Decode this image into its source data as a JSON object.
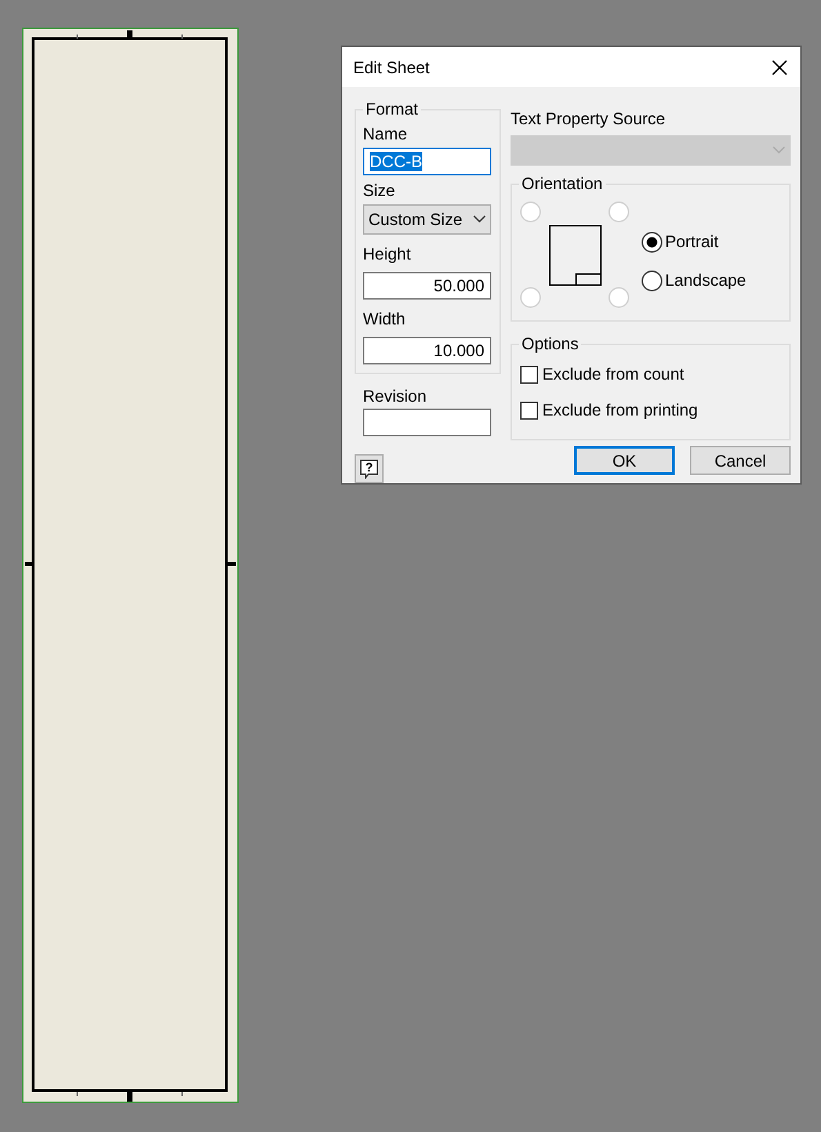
{
  "dialog": {
    "title": "Edit Sheet",
    "help_button": {
      "label": "?"
    },
    "format": {
      "legend": "Format",
      "name": {
        "label": "Name",
        "value": "DCC-B",
        "text_selected": true
      },
      "size": {
        "label": "Size",
        "value": "Custom Size"
      },
      "height": {
        "label": "Height",
        "value": "50.000"
      },
      "width": {
        "label": "Width",
        "value": "10.000"
      }
    },
    "revision": {
      "label": "Revision"
    },
    "text_property_source": {
      "label": "Text Property Source",
      "disabled": true
    },
    "orientation": {
      "legend": "Orientation",
      "anchors": [
        {
          "selected": false
        },
        {
          "selected": false
        },
        {
          "selected": false
        },
        {
          "selected": false
        }
      ],
      "choices": [
        {
          "label": "Portrait",
          "selected": true
        },
        {
          "label": "Landscape",
          "selected": false
        }
      ]
    },
    "options": {
      "legend": "Options",
      "items": [
        {
          "label": "Exclude from count",
          "checked": false
        },
        {
          "label": "Exclude from printing",
          "checked": false
        }
      ]
    },
    "buttons": [
      {
        "label": "OK",
        "default": true
      },
      {
        "label": "Cancel",
        "default": false
      }
    ]
  }
}
